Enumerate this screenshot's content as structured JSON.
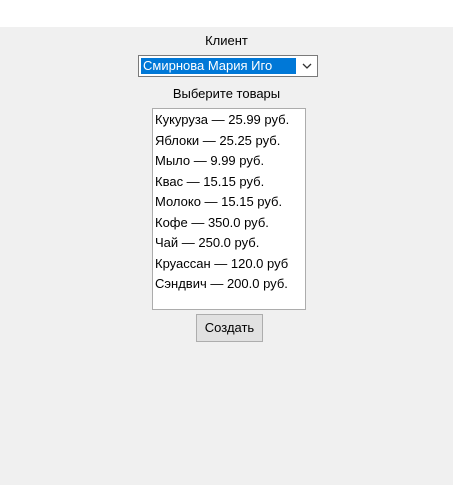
{
  "form": {
    "client_label": "Клиент",
    "client_selected": "Смирнова Мария Иго",
    "products_label": "Выберите товары",
    "products": [
      "Кукуруза — 25.99 руб.",
      "Яблоки — 25.25 руб.",
      "Мыло — 9.99 руб.",
      "Квас — 15.15 руб.",
      "Молоко — 15.15 руб.",
      "Кофе — 350.0 руб.",
      "Чай — 250.0 руб.",
      "Круассан — 120.0 руб",
      "Сэндвич — 200.0 руб."
    ],
    "create_button": "Создать"
  },
  "icons": {
    "combo_arrow": "chevron-down-icon"
  },
  "colors": {
    "window_bg": "#f0f0f0",
    "selection": "#0078d7",
    "button_bg": "#e1e1e1"
  }
}
